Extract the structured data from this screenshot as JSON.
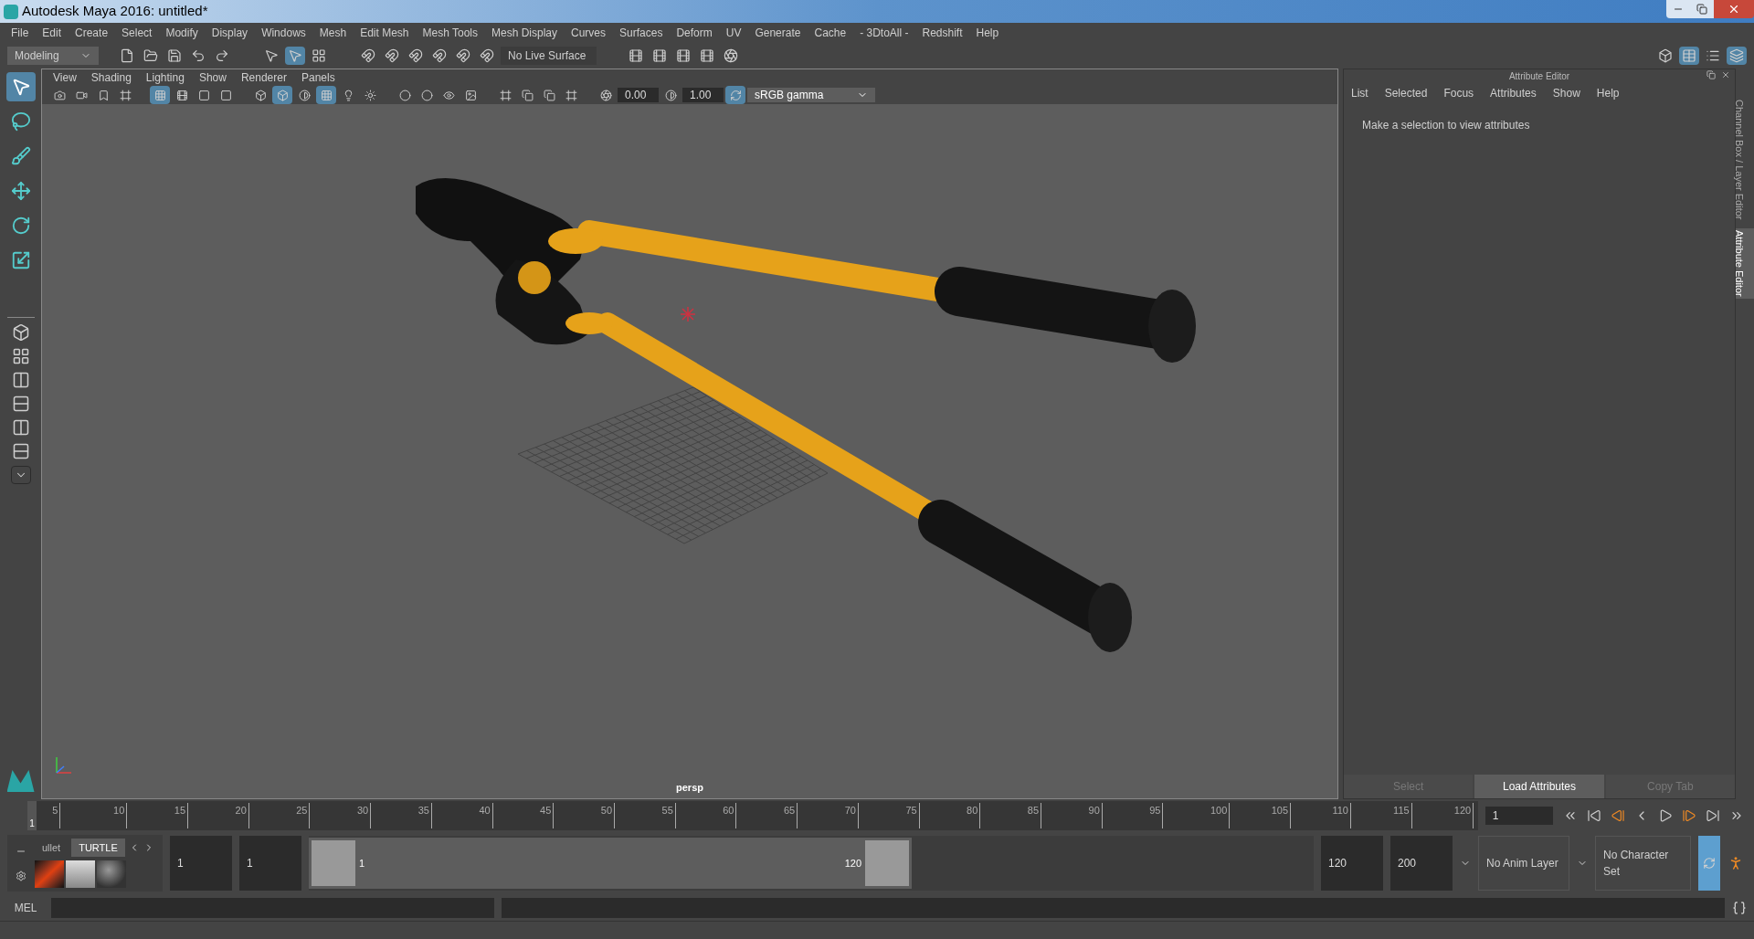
{
  "window": {
    "title": "Autodesk Maya 2016: untitled*"
  },
  "menu_bar": [
    "File",
    "Edit",
    "Create",
    "Select",
    "Modify",
    "Display",
    "Windows",
    "Mesh",
    "Edit Mesh",
    "Mesh Tools",
    "Mesh Display",
    "Curves",
    "Surfaces",
    "Deform",
    "UV",
    "Generate",
    "Cache",
    "- 3DtoAll -",
    "Redshift",
    "Help"
  ],
  "shelf_bar": {
    "menu_set": "Modeling",
    "live_surface": "No Live Surface"
  },
  "toolbox": [
    {
      "kind": "select",
      "selected": true
    },
    {
      "kind": "lasso",
      "selected": false
    },
    {
      "kind": "paint",
      "selected": false
    },
    {
      "kind": "move",
      "selected": false
    },
    {
      "kind": "rotate",
      "selected": false
    },
    {
      "kind": "scale",
      "selected": false
    }
  ],
  "viewport": {
    "menus": [
      "View",
      "Shading",
      "Lighting",
      "Show",
      "Renderer",
      "Panels"
    ],
    "exposure": "0.00",
    "gamma": "1.00",
    "color_space": "sRGB gamma",
    "camera": "persp"
  },
  "attribute_editor": {
    "title": "Attribute Editor",
    "menus": [
      "List",
      "Selected",
      "Focus",
      "Attributes",
      "Show",
      "Help"
    ],
    "message": "Make a selection to view attributes",
    "buttons": [
      {
        "label": "Select",
        "disabled": true
      },
      {
        "label": "Load Attributes",
        "disabled": false
      },
      {
        "label": "Copy Tab",
        "disabled": true
      }
    ]
  },
  "side_tabs": [
    {
      "label": "Channel Box / Layer Editor",
      "selected": false
    },
    {
      "label": "Attribute Editor",
      "selected": true
    }
  ],
  "time_slider": {
    "current": "1",
    "level": 0,
    "ticks": [
      "5",
      "10",
      "15",
      "20",
      "25",
      "30",
      "35",
      "40",
      "45",
      "50",
      "55",
      "60",
      "65",
      "70",
      "75",
      "80",
      "85",
      "90",
      "95",
      "100",
      "105",
      "110",
      "115",
      "120"
    ],
    "current_frame": "1"
  },
  "range_slider": {
    "shelf_tabs": [
      {
        "label": "ullet",
        "selected": false
      },
      {
        "label": "TURTLE",
        "selected": true
      }
    ],
    "handles": [
      {
        "level": 0
      },
      {
        "level": 1
      }
    ],
    "start": "1",
    "playback_start": "1",
    "range_start": "1",
    "range_end": "120",
    "playback_end": "120",
    "end": "200",
    "anim_layer": "No Anim Layer",
    "character_set": "No Character Set"
  },
  "command_line": {
    "label": "MEL"
  }
}
